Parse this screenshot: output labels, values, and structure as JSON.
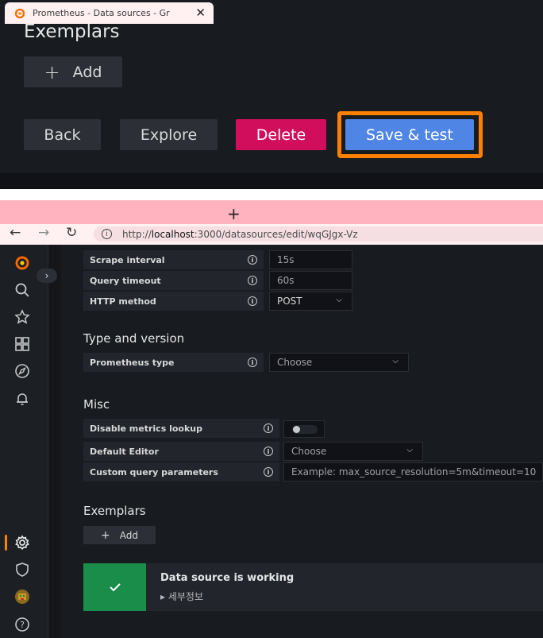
{
  "top_panel": {
    "title": "Exemplars",
    "add_label": "Add",
    "back_label": "Back",
    "explore_label": "Explore",
    "delete_label": "Delete",
    "save_test_label": "Save & test"
  },
  "browser": {
    "tab_title": "Prometheus - Data sources - Gr",
    "tab_close": "✕",
    "new_tab": "+",
    "back": "←",
    "forward": "→",
    "reload": "↻",
    "url_prefix": "http://",
    "url_host": "localhost",
    "url_rest": ":3000/datasources/edit/wqGJgx-Vz"
  },
  "settings": {
    "scrape_interval": {
      "label": "Scrape interval",
      "placeholder": "15s"
    },
    "query_timeout": {
      "label": "Query timeout",
      "placeholder": "60s"
    },
    "http_method": {
      "label": "HTTP method",
      "value": "POST"
    },
    "type_version_title": "Type and version",
    "prometheus_type": {
      "label": "Prometheus type",
      "placeholder": "Choose"
    },
    "misc_title": "Misc",
    "disable_metrics_lookup": {
      "label": "Disable metrics lookup"
    },
    "default_editor": {
      "label": "Default Editor",
      "placeholder": "Choose"
    },
    "custom_query_params": {
      "label": "Custom query parameters",
      "placeholder": "Example: max_source_resolution=5m&timeout=10"
    },
    "exemplars_title": "Exemplars",
    "add_label": "Add"
  },
  "alert": {
    "message": "Data source is working",
    "details": "▸ 세부정보"
  },
  "colors": {
    "accent_orange": "#ff7f00",
    "primary_blue": "#4f85e4",
    "destructive": "#d10e5c",
    "success": "#1b8d4a",
    "bg_dark": "#181b1f"
  },
  "icons": [
    "grafana-logo",
    "search-icon",
    "star-icon",
    "dashboards-icon",
    "explore-icon",
    "alert-bell-icon",
    "gear-icon",
    "shield-icon",
    "user-avatar",
    "help-icon",
    "info-icon",
    "chevron-down-icon",
    "check-icon"
  ]
}
